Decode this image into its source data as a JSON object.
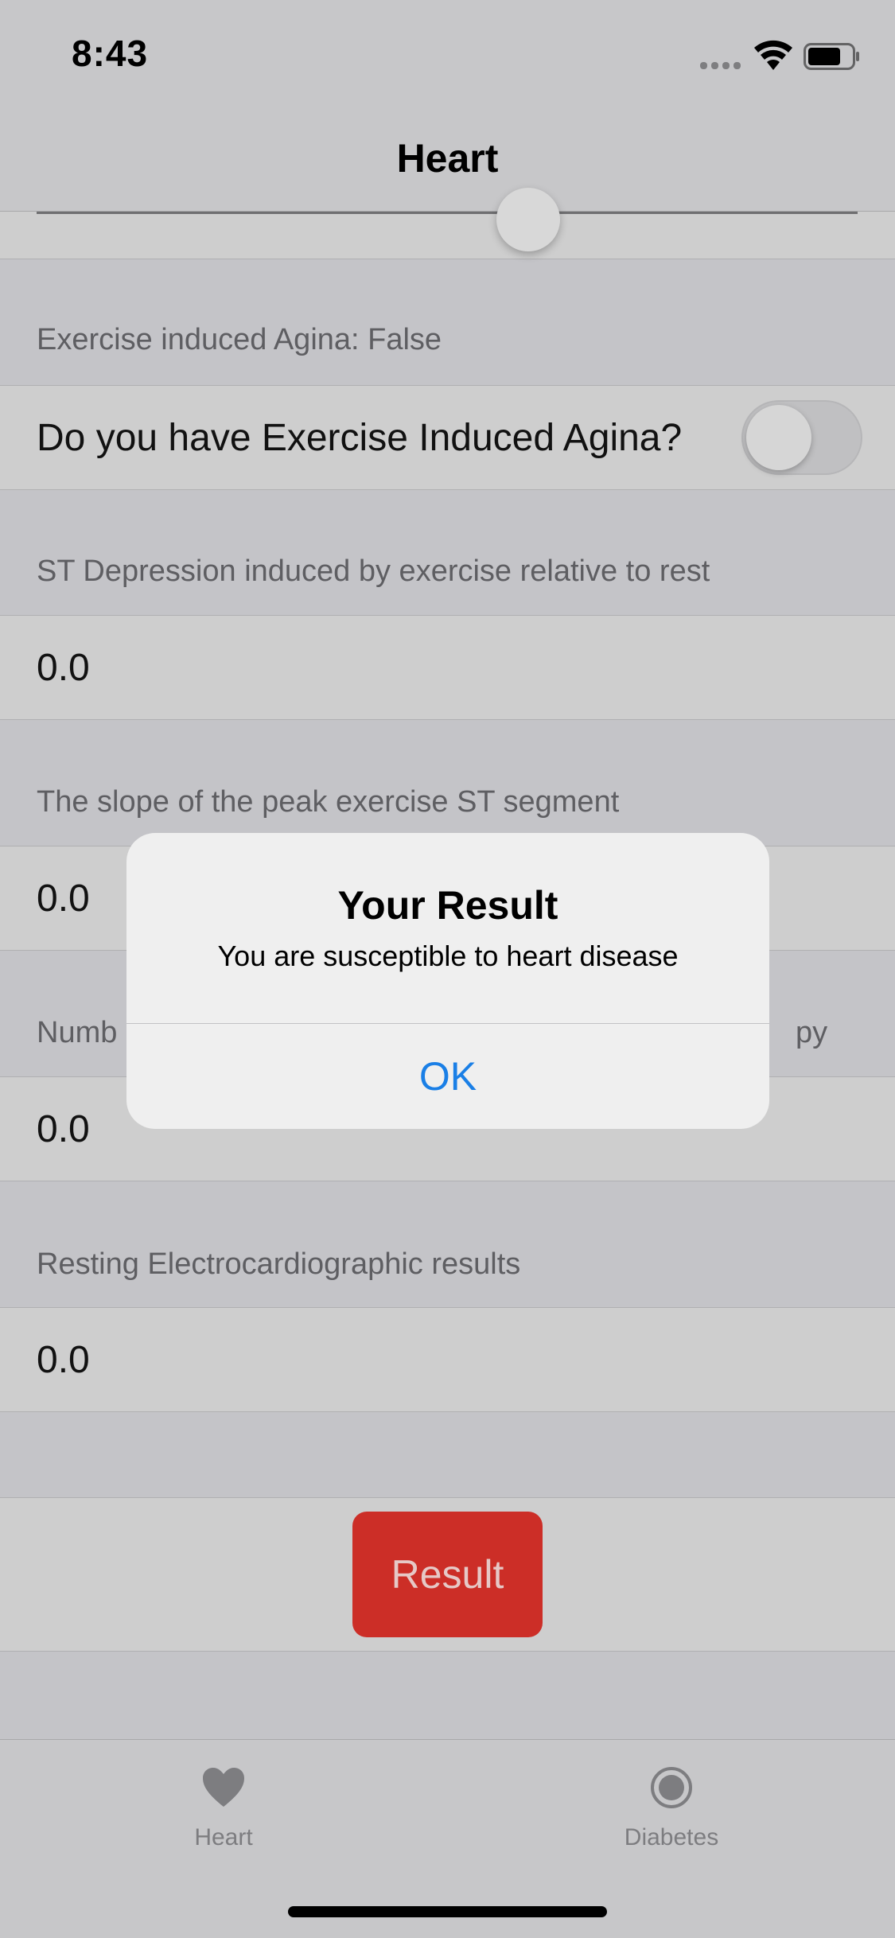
{
  "status_bar": {
    "time": "8:43"
  },
  "nav": {
    "title": "Heart"
  },
  "exercise_angina": {
    "header": "Exercise induced Agina: False",
    "question": "Do you have Exercise Induced Agina?",
    "toggle_on": false
  },
  "st_depression": {
    "header": "ST Depression induced by exercise relative to rest",
    "value": "0.0"
  },
  "slope": {
    "header": "The slope of the peak exercise ST segment",
    "value": "0.0"
  },
  "vessels": {
    "header_left": "Numb",
    "header_right": "py",
    "value": "0.0"
  },
  "resting_ecg": {
    "header": "Resting Electrocardiographic results",
    "value": "0.0"
  },
  "result_button": {
    "label": "Result"
  },
  "alert": {
    "title": "Your Result",
    "message": "You are susceptible to heart disease",
    "ok_label": "OK"
  },
  "tabs": [
    {
      "label": "Heart",
      "icon": "heart-icon"
    },
    {
      "label": "Diabetes",
      "icon": "diabetes-icon"
    }
  ],
  "colors": {
    "accent": "#1a7fe6",
    "result_button": "#cc2e27"
  }
}
